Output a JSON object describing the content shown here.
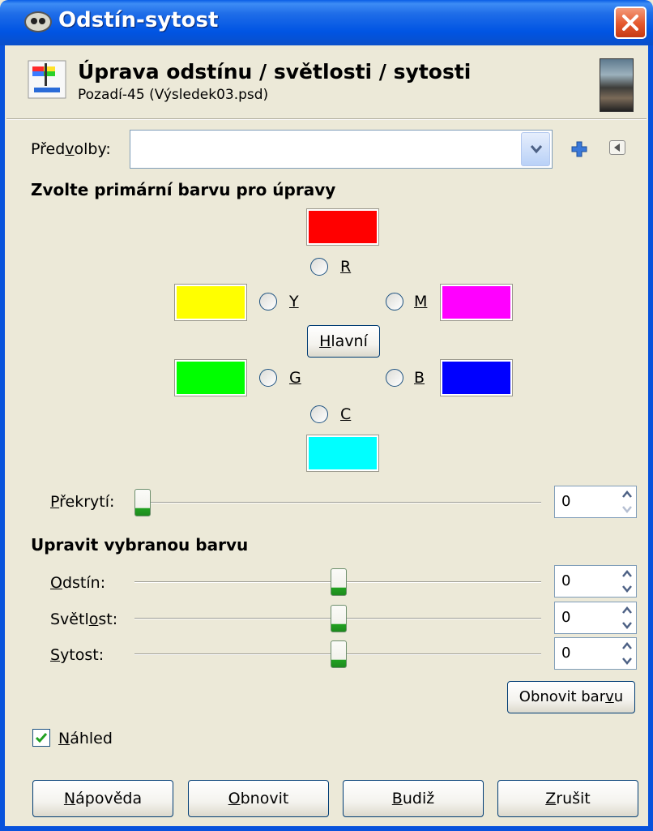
{
  "window": {
    "title": "Odstín-sytost"
  },
  "header": {
    "title": "Úprava odstínu / světlosti / sytosti",
    "subtitle": "Pozadí-45 (Výsledek03.psd)"
  },
  "presets": {
    "label_pre": "Před",
    "label_u": "v",
    "label_post": "olby:",
    "value": ""
  },
  "primary": {
    "heading": "Zvolte primární barvu pro úpravy",
    "colors": {
      "R": {
        "label": "R",
        "swatch": "#ff0000"
      },
      "Y": {
        "label": "Y",
        "swatch": "#ffff00"
      },
      "M": {
        "label": "M",
        "swatch": "#ff00ff"
      },
      "G": {
        "label": "G",
        "swatch": "#00ff00"
      },
      "B": {
        "label": "B",
        "swatch": "#0000ff"
      },
      "C": {
        "label": "C",
        "swatch": "#00ffff"
      }
    },
    "master_u": "H",
    "master_rest": "lavní"
  },
  "overlap": {
    "label_u": "P",
    "label_rest": "řekrytí:",
    "value": "0"
  },
  "adjust": {
    "heading": "Upravit vybranou barvu",
    "hue": {
      "label_u": "O",
      "label_rest": "dstín:",
      "value": "0"
    },
    "lightness": {
      "label_pre": "Světl",
      "label_u": "o",
      "label_post": "st:",
      "value": "0"
    },
    "saturation": {
      "label_u": "S",
      "label_rest": "ytost:",
      "value": "0"
    },
    "reset_color": {
      "pre": "Obnovit bar",
      "u": "v",
      "post": "u"
    }
  },
  "preview": {
    "label_u": "N",
    "label_rest": "áhled",
    "checked": true
  },
  "buttons": {
    "help": {
      "u": "N",
      "rest": "ápověda"
    },
    "reset": {
      "u": "O",
      "rest": "bnovit"
    },
    "ok": {
      "u": "B",
      "rest": "udiž"
    },
    "cancel": {
      "u": "Z",
      "rest": "rušit"
    }
  }
}
